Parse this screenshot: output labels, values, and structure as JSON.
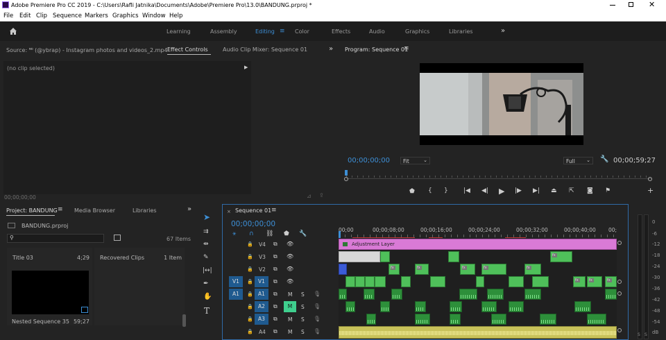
{
  "window": {
    "title": "Adobe Premiere Pro CC 2019 - C:\\Users\\Rafli Jatnika\\Documents\\Adobe\\Premiere Pro\\13.0\\BANDUNG.prproj *"
  },
  "menu": [
    "File",
    "Edit",
    "Clip",
    "Sequence",
    "Markers",
    "Graphics",
    "Window",
    "Help"
  ],
  "workspaces": [
    "Learning",
    "Assembly",
    "Editing",
    "Color",
    "Effects",
    "Audio",
    "Graphics",
    "Libraries"
  ],
  "active_workspace": "Editing",
  "source_panel": {
    "tabs": [
      "Source: 🅫 (@ybrap) - Instagram photos and videos_2.mp4",
      "Effect Controls",
      "Audio Clip Mixer: Sequence 01"
    ],
    "no_clip": "(no clip selected)",
    "timecode": "00;00;00;00"
  },
  "program_monitor": {
    "title": "Program: Sequence 01",
    "timecode": "00;00;00;00",
    "fit": "Fit",
    "quality": "Full",
    "duration": "00;00;59;27"
  },
  "project_panel": {
    "tabs": [
      "Project: BANDUNG",
      "Media Browser",
      "Libraries"
    ],
    "file": "BANDUNG.prproj",
    "items_count": "67 Items",
    "bins": [
      {
        "name": "Title 03",
        "duration": "4;29"
      },
      {
        "name": "Recovered Clips",
        "duration": "1 Item"
      }
    ],
    "nested": {
      "name": "Nested Sequence 35",
      "duration": "59;27"
    }
  },
  "timeline": {
    "tab": "Sequence 01",
    "timecode": "00;00;00;00",
    "ruler": [
      "00;00",
      "00;00;08;00",
      "00;00;16;00",
      "00;00;24;00",
      "00;00;32;00",
      "00;00;40;00",
      "00;"
    ],
    "tracks": [
      {
        "name": "V4",
        "src": ""
      },
      {
        "name": "V3",
        "src": ""
      },
      {
        "name": "V2",
        "src": ""
      },
      {
        "name": "V1",
        "src": "V1"
      },
      {
        "name": "A1",
        "src": "A1"
      },
      {
        "name": "A2",
        "src": ""
      },
      {
        "name": "A3",
        "src": ""
      },
      {
        "name": "A4",
        "src": ""
      }
    ],
    "adjustment_layer": "Adjustment Layer",
    "m_label": "M",
    "s_label": "S"
  },
  "meter": {
    "ticks": [
      "0",
      "-6",
      "-12",
      "-18",
      "-24",
      "-30",
      "-36",
      "-42",
      "-48",
      "-54",
      "dB"
    ],
    "s_labels": [
      "S",
      "S"
    ]
  },
  "colors": {
    "accent": "#3d8fd6",
    "adjustment": "#d97ad6",
    "clip_green": "#4fc05a"
  }
}
